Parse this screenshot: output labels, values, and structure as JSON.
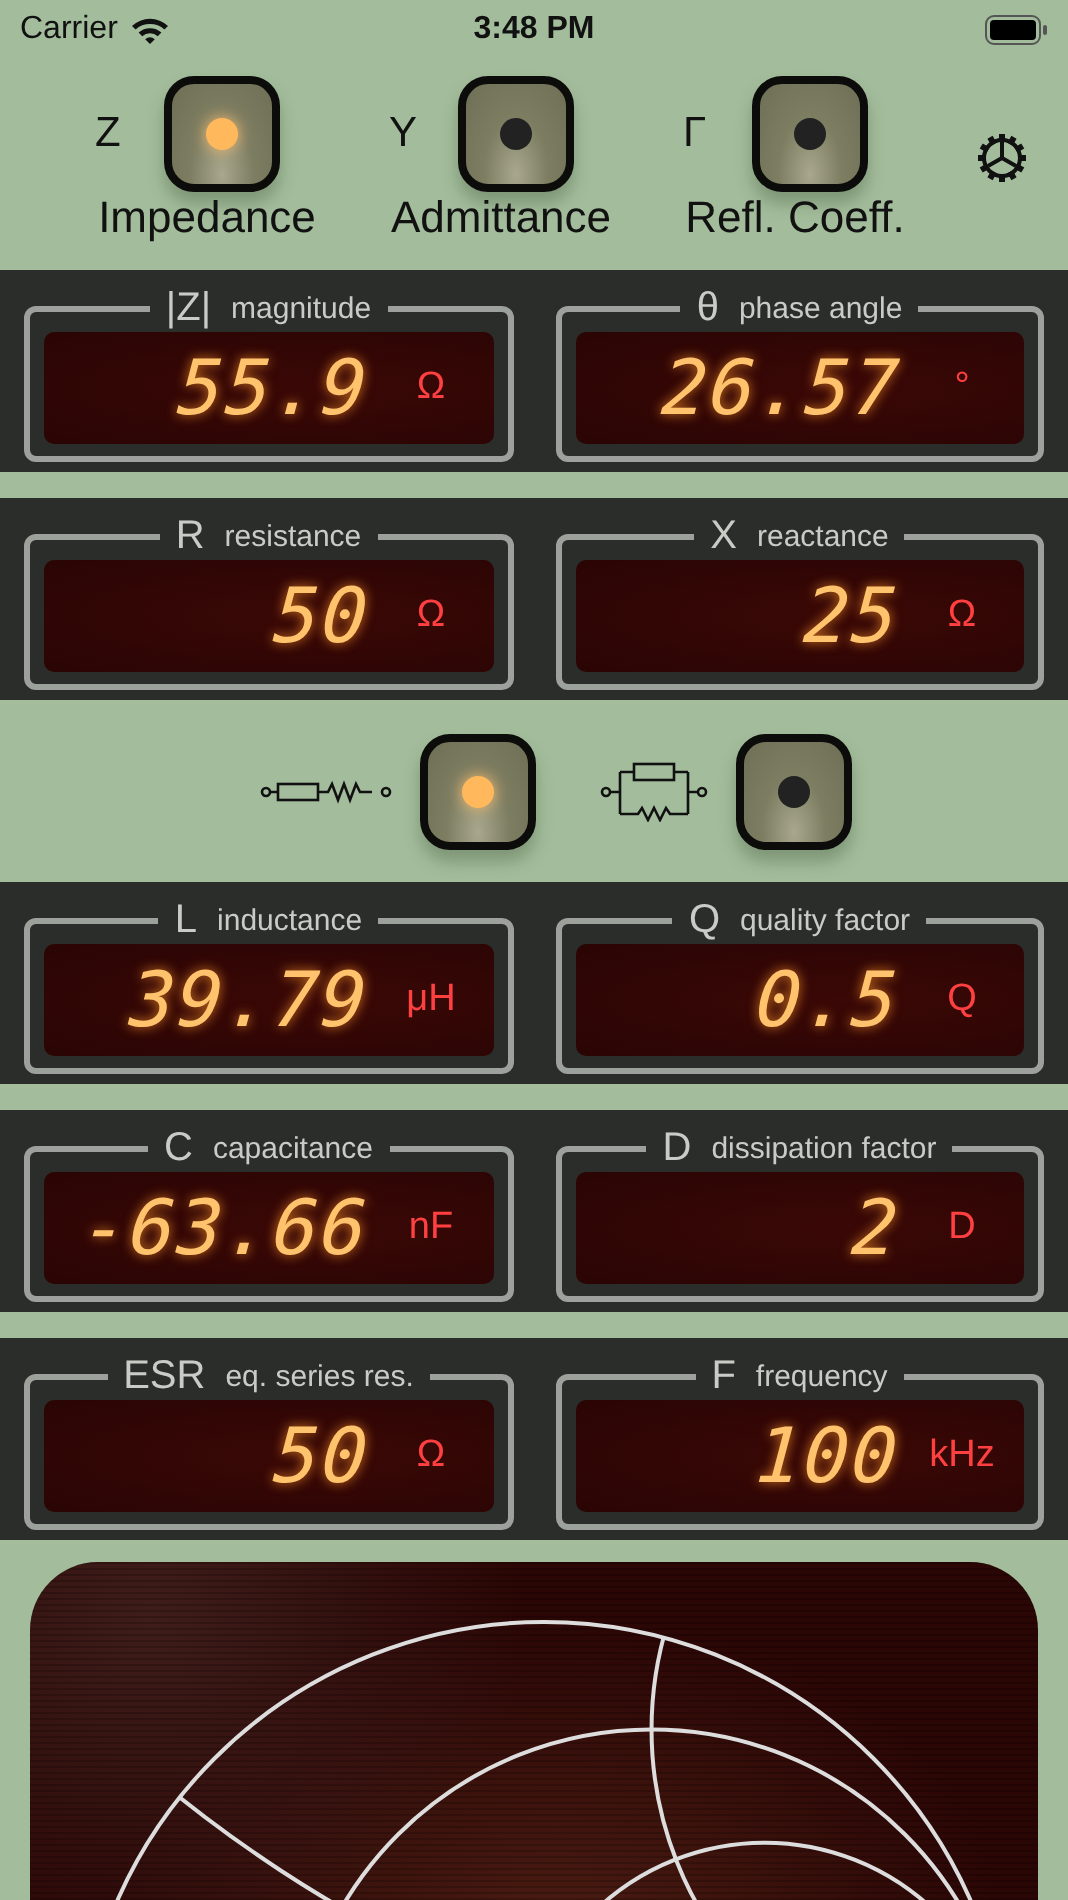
{
  "status_bar": {
    "carrier": "Carrier",
    "time": "3:48 PM"
  },
  "modes": [
    {
      "symbol": "Z",
      "label": "Impedance",
      "selected": true
    },
    {
      "symbol": "Y",
      "label": "Admittance",
      "selected": false
    },
    {
      "symbol": "Γ",
      "label": "Refl. Coeff.",
      "selected": false
    }
  ],
  "meter_rows_top": [
    [
      {
        "symbol": "|Z|",
        "label": "magnitude",
        "value": "55.9",
        "unit": "Ω"
      },
      {
        "symbol": "θ",
        "label": "phase angle",
        "value": "26.57",
        "unit": "°"
      }
    ],
    [
      {
        "symbol": "R",
        "label": "resistance",
        "value": "50",
        "unit": "Ω"
      },
      {
        "symbol": "X",
        "label": "reactance",
        "value": "25",
        "unit": "Ω"
      }
    ]
  ],
  "circuit_modes": [
    {
      "kind": "series",
      "selected": true
    },
    {
      "kind": "parallel",
      "selected": false
    }
  ],
  "meter_rows_bottom": [
    [
      {
        "symbol": "L",
        "label": "inductance",
        "value": "39.79",
        "unit": "μH"
      },
      {
        "symbol": "Q",
        "label": "quality factor",
        "value": "0.5",
        "unit": "Q"
      }
    ],
    [
      {
        "symbol": "C",
        "label": "capacitance",
        "value": "-63.66",
        "unit": "nF"
      },
      {
        "symbol": "D",
        "label": "dissipation factor",
        "value": "2",
        "unit": "D"
      }
    ],
    [
      {
        "symbol": "ESR",
        "label": "eq. series res.",
        "value": "50",
        "unit": "Ω"
      },
      {
        "symbol": "F",
        "label": "frequency",
        "value": "100",
        "unit": "kHz"
      }
    ]
  ]
}
